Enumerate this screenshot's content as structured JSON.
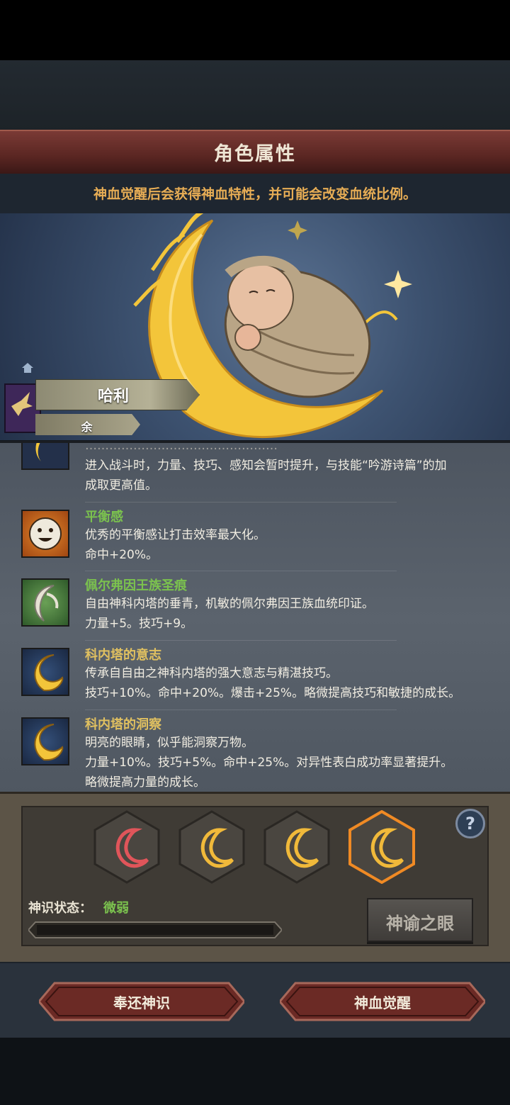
{
  "header": {
    "title": "角色属性"
  },
  "notice": "神血觉醒后会获得神血特性，并可能会改变血统比例。",
  "character": {
    "name": "哈利",
    "sub": "余"
  },
  "traits": [
    {
      "name": "",
      "name_color": "#e0c060",
      "icon": "crescent-icon",
      "lines": [
        "…………………………………………",
        "进入战斗时，力量、技巧、感知会暂时提升，与技能“吟游诗篇”的加",
        "成取更高值。"
      ]
    },
    {
      "name": "平衡感",
      "name_color": "#7bc24e",
      "icon": "smiley-face-icon",
      "lines": [
        "优秀的平衡感让打击效率最大化。",
        "命中+20%。"
      ]
    },
    {
      "name": "佩尔弗因王族圣痕",
      "name_color": "#7bc24e",
      "icon": "white-crescent-icon",
      "lines": [
        "自由神科内塔的垂青，机敏的佩尔弗因王族血统印证。",
        "力量+5。技巧+9。"
      ]
    },
    {
      "name": "科内塔的意志",
      "name_color": "#e0c060",
      "icon": "golden-crescent-icon",
      "lines": [
        "传承自自由之神科内塔的强大意志与精湛技巧。",
        "技巧+10%。命中+20%。爆击+25%。略微提高技巧和敏捷的成长。"
      ]
    },
    {
      "name": "科内塔的洞察",
      "name_color": "#e0c060",
      "icon": "golden-crescent-icon",
      "lines": [
        "明亮的眼睛，似乎能洞察万物。",
        "力量+10%。技巧+5%。命中+25%。对异性表白成功率显著提升。",
        "略微提高力量的成长。"
      ]
    }
  ],
  "divine": {
    "status_label": "神识状态：",
    "status_value": "微弱",
    "progress": 0.0,
    "help": "?",
    "oracle_button": "神谕之眼",
    "slots": [
      "red-crescent-icon",
      "gold-crescent-icon",
      "gold-crescent-icon",
      "gold-crescent-selected-icon"
    ]
  },
  "actions": {
    "return_label": "奉还神识",
    "awaken_label": "神血觉醒"
  },
  "colors": {
    "accent_gold": "#e7ad55",
    "green": "#7bc24e",
    "header_red": "#5a2622"
  }
}
